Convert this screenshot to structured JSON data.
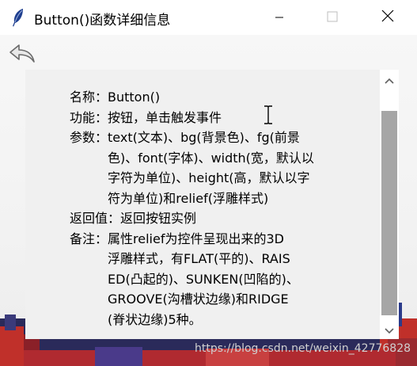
{
  "window": {
    "title": "Button()函数详细信息"
  },
  "icons": {
    "app": "feather-icon",
    "minimize": "minimize-icon",
    "maximize": "maximize-icon",
    "close": "close-icon",
    "back": "back-arrow-icon",
    "scroll_up": "chevron-up-icon",
    "scroll_down": "chevron-down-icon"
  },
  "info": {
    "name_label": "名称：",
    "name_value": "Button()",
    "func_label": "功能：",
    "func_value": "按钮，单击触发事件",
    "params_label": "参数：",
    "params_lines": [
      "text(文本)、bg(背景色)、fg(前景",
      "色)、font(字体)、width(宽，默认以",
      "字符为单位)、height(高，默认以字",
      "符为单位)和relief(浮雕样式)"
    ],
    "return_label": "返回值：",
    "return_value": "返回按钮实例",
    "note_label": "备注：",
    "note_lines": [
      "属性relief为控件呈现出来的3D",
      "浮雕样式，有FLAT(平的)、RAIS",
      "ED(凸起的)、SUNKEN(凹陷的)、",
      "GROOVE(沟槽状边缘)和RIDGE",
      "(脊状边缘)5种。"
    ]
  },
  "scrollbar": {
    "position_fraction": 0.18
  },
  "watermark": "https://blog.csdn.net/weixin_42776828",
  "colors": {
    "titlebar": "#ffffff",
    "panel": "#f0f0f0",
    "thumb": "#a6a6a6",
    "city_red": "#c0302a",
    "city_blue": "#2a3a8a"
  }
}
